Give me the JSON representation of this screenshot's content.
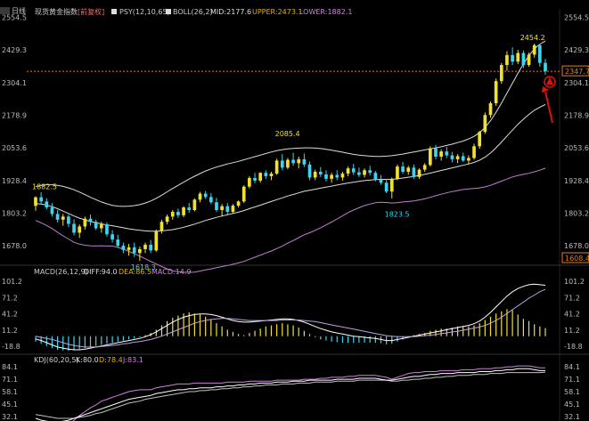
{
  "header": {
    "top_left_label": "日线",
    "symbol_label": "现货黄金指数",
    "adjust_label": "[前复权]",
    "psy_label": "PSY(12,10,65)",
    "boll_label": "BOLL(26,2)",
    "boll_mid": "MID:2177.6",
    "boll_upper": "UPPER:2473.1",
    "boll_lower": "LOWER:1882.1"
  },
  "macd_panel": {
    "title": "MACD(26,12,9)",
    "diff": "DIFF:94.0",
    "dea": "DEA:86.5",
    "macd": "MACD:14.9"
  },
  "kdj_panel": {
    "title": "KDJ(60,20,5)",
    "k": "K:80.0",
    "d": "D:78.4",
    "j": "J:83.1"
  },
  "axes": {
    "main_ticks": [
      "2554.5",
      "2429.3",
      "2304.1",
      "2178.9",
      "2053.6",
      "1928.4",
      "1803.2",
      "1678.0"
    ],
    "macd_ticks": [
      "101.2",
      "71.2",
      "41.2",
      "11.2",
      "-18.8"
    ],
    "kdj_ticks": [
      "84.1",
      "71.1",
      "58.1",
      "45.1",
      "32.1"
    ],
    "current_price": "2347.7",
    "lower_tag": "1608.4"
  },
  "annotations": {
    "high": "2454.2",
    "p1": "1882.5",
    "p2": "2085.4",
    "p3": "1823.5",
    "low": "1618.3"
  },
  "colors": {
    "up": "#f0e030",
    "down": "#3cd4f0",
    "boll": "#dddddd",
    "lower_band": "#c080d0",
    "price_line": "#e08020",
    "arrow": "#e01010",
    "macd_pos": "#f0e030",
    "macd_neg": "#3cd4f0"
  },
  "chart_data": {
    "type": "candlestick",
    "ylim": [
      1610,
      2560
    ],
    "ohlc": [
      [
        1831,
        1868,
        1812,
        1864
      ],
      [
        1864,
        1883,
        1840,
        1848
      ],
      [
        1848,
        1860,
        1818,
        1825
      ],
      [
        1825,
        1842,
        1790,
        1800
      ],
      [
        1800,
        1815,
        1768,
        1778
      ],
      [
        1778,
        1800,
        1755,
        1790
      ],
      [
        1790,
        1798,
        1750,
        1762
      ],
      [
        1762,
        1780,
        1718,
        1728
      ],
      [
        1728,
        1760,
        1708,
        1752
      ],
      [
        1752,
        1790,
        1740,
        1782
      ],
      [
        1782,
        1798,
        1755,
        1770
      ],
      [
        1770,
        1778,
        1738,
        1745
      ],
      [
        1745,
        1770,
        1728,
        1760
      ],
      [
        1760,
        1768,
        1712,
        1722
      ],
      [
        1722,
        1738,
        1690,
        1702
      ],
      [
        1702,
        1720,
        1670,
        1678
      ],
      [
        1678,
        1690,
        1650,
        1662
      ],
      [
        1662,
        1685,
        1640,
        1672
      ],
      [
        1672,
        1690,
        1635,
        1650
      ],
      [
        1650,
        1675,
        1620,
        1665
      ],
      [
        1665,
        1690,
        1650,
        1682
      ],
      [
        1682,
        1700,
        1650,
        1660
      ],
      [
        1660,
        1740,
        1655,
        1735
      ],
      [
        1735,
        1778,
        1725,
        1770
      ],
      [
        1770,
        1798,
        1760,
        1790
      ],
      [
        1790,
        1815,
        1778,
        1808
      ],
      [
        1808,
        1820,
        1785,
        1795
      ],
      [
        1795,
        1830,
        1788,
        1825
      ],
      [
        1825,
        1842,
        1805,
        1815
      ],
      [
        1815,
        1860,
        1810,
        1855
      ],
      [
        1855,
        1885,
        1845,
        1878
      ],
      [
        1878,
        1888,
        1858,
        1865
      ],
      [
        1865,
        1880,
        1838,
        1845
      ],
      [
        1845,
        1862,
        1808,
        1815
      ],
      [
        1815,
        1838,
        1790,
        1830
      ],
      [
        1830,
        1842,
        1798,
        1808
      ],
      [
        1808,
        1838,
        1800,
        1832
      ],
      [
        1832,
        1852,
        1825,
        1848
      ],
      [
        1848,
        1910,
        1842,
        1905
      ],
      [
        1905,
        1945,
        1898,
        1938
      ],
      [
        1938,
        1958,
        1918,
        1928
      ],
      [
        1928,
        1960,
        1920,
        1958
      ],
      [
        1958,
        1968,
        1935,
        1945
      ],
      [
        1945,
        1962,
        1930,
        1955
      ],
      [
        1955,
        2012,
        1950,
        2005
      ],
      [
        2005,
        2030,
        1968,
        1978
      ],
      [
        1978,
        2015,
        1972,
        2008
      ],
      [
        2008,
        2035,
        1985,
        1995
      ],
      [
        1995,
        2020,
        1975,
        2010
      ],
      [
        2010,
        2032,
        1980,
        1990
      ],
      [
        1990,
        2002,
        1930,
        1940
      ],
      [
        1940,
        1970,
        1930,
        1962
      ],
      [
        1962,
        1980,
        1942,
        1952
      ],
      [
        1952,
        1968,
        1925,
        1935
      ],
      [
        1935,
        1958,
        1920,
        1950
      ],
      [
        1950,
        1968,
        1930,
        1940
      ],
      [
        1940,
        1962,
        1928,
        1955
      ],
      [
        1955,
        1982,
        1945,
        1975
      ],
      [
        1975,
        1992,
        1950,
        1960
      ],
      [
        1960,
        1978,
        1942,
        1950
      ],
      [
        1950,
        1975,
        1940,
        1968
      ],
      [
        1968,
        1985,
        1948,
        1958
      ],
      [
        1958,
        1965,
        1925,
        1932
      ],
      [
        1932,
        1950,
        1912,
        1920
      ],
      [
        1920,
        1935,
        1880,
        1886
      ],
      [
        1886,
        1940,
        1860,
        1935
      ],
      [
        1935,
        1990,
        1930,
        1982
      ],
      [
        1982,
        2000,
        1955,
        1962
      ],
      [
        1962,
        1985,
        1950,
        1978
      ],
      [
        1978,
        1990,
        1935,
        1942
      ],
      [
        1942,
        1975,
        1935,
        1970
      ],
      [
        1970,
        1995,
        1962,
        1988
      ],
      [
        1988,
        2060,
        1982,
        2052
      ],
      [
        2052,
        2065,
        2010,
        2020
      ],
      [
        2020,
        2048,
        2005,
        2040
      ],
      [
        2040,
        2058,
        2015,
        2025
      ],
      [
        2025,
        2038,
        1998,
        2010
      ],
      [
        2010,
        2030,
        1995,
        2022
      ],
      [
        2022,
        2035,
        2000,
        2005
      ],
      [
        2005,
        2025,
        1990,
        2015
      ],
      [
        2015,
        2070,
        2008,
        2060
      ],
      [
        2060,
        2120,
        2050,
        2115
      ],
      [
        2115,
        2190,
        2108,
        2180
      ],
      [
        2180,
        2232,
        2170,
        2225
      ],
      [
        2225,
        2320,
        2215,
        2310
      ],
      [
        2310,
        2380,
        2300,
        2372
      ],
      [
        2372,
        2425,
        2350,
        2410
      ],
      [
        2410,
        2440,
        2372,
        2385
      ],
      [
        2385,
        2430,
        2375,
        2418
      ],
      [
        2418,
        2428,
        2360,
        2372
      ],
      [
        2372,
        2420,
        2365,
        2412
      ],
      [
        2412,
        2454,
        2400,
        2448
      ],
      [
        2448,
        2452,
        2365,
        2380
      ],
      [
        2380,
        2395,
        2335,
        2348
      ]
    ],
    "boll_mid": [
      1840,
      1838,
      1834,
      1828,
      1820,
      1811,
      1802,
      1792,
      1784,
      1777,
      1771,
      1766,
      1762,
      1758,
      1755,
      1751,
      1747,
      1743,
      1740,
      1737,
      1735,
      1734,
      1734,
      1735,
      1737,
      1740,
      1744,
      1749,
      1755,
      1761,
      1768,
      1775,
      1781,
      1787,
      1792,
      1797,
      1802,
      1807,
      1813,
      1820,
      1827,
      1834,
      1841,
      1848,
      1855,
      1862,
      1869,
      1875,
      1881,
      1887,
      1891,
      1895,
      1899,
      1903,
      1907,
      1911,
      1915,
      1919,
      1922,
      1925,
      1928,
      1930,
      1932,
      1933,
      1933,
      1933,
      1935,
      1938,
      1941,
      1944,
      1948,
      1952,
      1957,
      1962,
      1967,
      1972,
      1977,
      1982,
      1987,
      1992,
      1998,
      2006,
      2018,
      2034,
      2054,
      2076,
      2099,
      2122,
      2144,
      2164,
      2182,
      2198,
      2210,
      2220
    ],
    "boll_upper": [
      1905,
      1910,
      1912,
      1912,
      1910,
      1906,
      1900,
      1893,
      1884,
      1874,
      1864,
      1855,
      1846,
      1839,
      1833,
      1830,
      1829,
      1830,
      1832,
      1836,
      1842,
      1850,
      1860,
      1872,
      1885,
      1898,
      1910,
      1922,
      1934,
      1945,
      1955,
      1965,
      1973,
      1980,
      1986,
      1992,
      1997,
      2002,
      2008,
      2014,
      2020,
      2026,
      2032,
      2038,
      2043,
      2047,
      2050,
      2052,
      2053,
      2054,
      2054,
      2053,
      2051,
      2048,
      2045,
      2041,
      2037,
      2033,
      2029,
      2026,
      2024,
      2022,
      2021,
      2021,
      2022,
      2024,
      2027,
      2030,
      2034,
      2038,
      2042,
      2046,
      2050,
      2054,
      2058,
      2063,
      2068,
      2074,
      2080,
      2088,
      2098,
      2112,
      2132,
      2158,
      2190,
      2226,
      2264,
      2302,
      2340,
      2376,
      2408,
      2434,
      2452,
      2464
    ],
    "boll_lower": [
      1775,
      1766,
      1756,
      1744,
      1730,
      1716,
      1704,
      1691,
      1684,
      1680,
      1678,
      1677,
      1678,
      1677,
      1677,
      1672,
      1665,
      1656,
      1648,
      1638,
      1628,
      1618,
      1608,
      1598,
      1589,
      1582,
      1578,
      1576,
      1576,
      1577,
      1581,
      1585,
      1589,
      1594,
      1598,
      1602,
      1607,
      1612,
      1618,
      1626,
      1634,
      1642,
      1650,
      1658,
      1667,
      1677,
      1688,
      1698,
      1709,
      1720,
      1728,
      1737,
      1747,
      1758,
      1769,
      1781,
      1793,
      1805,
      1815,
      1824,
      1832,
      1838,
      1843,
      1845,
      1844,
      1842,
      1843,
      1846,
      1848,
      1850,
      1854,
      1858,
      1864,
      1870,
      1876,
      1881,
      1886,
      1890,
      1894,
      1896,
      1898,
      1900,
      1904,
      1910,
      1918,
      1926,
      1934,
      1942,
      1948,
      1952,
      1956,
      1962,
      1968,
      1976
    ],
    "macd_bars": [
      -10,
      -14,
      -18,
      -22,
      -25,
      -26,
      -27,
      -26,
      -24,
      -22,
      -20,
      -18,
      -16,
      -14,
      -12,
      -10,
      -8,
      -6,
      -4,
      -2,
      2,
      6,
      12,
      20,
      28,
      34,
      38,
      42,
      44,
      42,
      40,
      36,
      30,
      24,
      18,
      12,
      8,
      4,
      2,
      6,
      10,
      14,
      18,
      20,
      22,
      24,
      22,
      20,
      16,
      10,
      4,
      -2,
      -6,
      -8,
      -10,
      -11,
      -12,
      -12,
      -12,
      -12,
      -12,
      -12,
      -12,
      -13,
      -15,
      -14,
      -10,
      -6,
      -2,
      2,
      4,
      6,
      10,
      12,
      14,
      14,
      16,
      18,
      18,
      18,
      20,
      24,
      30,
      36,
      42,
      46,
      50,
      48,
      40,
      32,
      28,
      22,
      18,
      15
    ],
    "macd_diff": [
      -5,
      -8,
      -12,
      -16,
      -20,
      -22,
      -24,
      -25,
      -25,
      -24,
      -22,
      -20,
      -18,
      -16,
      -14,
      -12,
      -10,
      -8,
      -6,
      -4,
      -1,
      3,
      8,
      14,
      20,
      26,
      31,
      35,
      38,
      40,
      41,
      41,
      40,
      38,
      35,
      32,
      29,
      27,
      26,
      26,
      27,
      28,
      29,
      30,
      31,
      32,
      32,
      31,
      29,
      26,
      22,
      18,
      14,
      11,
      8,
      6,
      4,
      2,
      0,
      -1,
      -2,
      -3,
      -4,
      -6,
      -8,
      -8,
      -6,
      -4,
      -2,
      0,
      2,
      4,
      6,
      8,
      10,
      12,
      14,
      16,
      18,
      20,
      23,
      28,
      35,
      44,
      54,
      64,
      74,
      82,
      88,
      92,
      95,
      96,
      95,
      94
    ],
    "macd_dea": [
      0,
      -2,
      -4,
      -6,
      -9,
      -12,
      -15,
      -17,
      -19,
      -20,
      -20,
      -20,
      -19,
      -18,
      -17,
      -16,
      -14,
      -13,
      -11,
      -10,
      -8,
      -6,
      -3,
      0,
      4,
      8,
      12,
      16,
      20,
      24,
      27,
      29,
      31,
      32,
      33,
      33,
      32,
      31,
      30,
      29,
      29,
      29,
      29,
      29,
      29,
      30,
      30,
      30,
      30,
      29,
      28,
      27,
      25,
      23,
      21,
      19,
      17,
      15,
      13,
      11,
      9,
      7,
      5,
      3,
      1,
      0,
      -1,
      -1,
      -1,
      -1,
      0,
      1,
      2,
      3,
      5,
      6,
      8,
      9,
      11,
      13,
      15,
      17,
      20,
      24,
      29,
      35,
      42,
      49,
      56,
      63,
      70,
      76,
      82,
      86.5
    ],
    "kdj_k": [
      30,
      28,
      27,
      26,
      26,
      27,
      28,
      30,
      32,
      34,
      36,
      38,
      40,
      42,
      44,
      46,
      48,
      50,
      51,
      52,
      53,
      54,
      56,
      57,
      58,
      59,
      60,
      60,
      61,
      61,
      62,
      62,
      62,
      63,
      63,
      64,
      64,
      65,
      65,
      66,
      66,
      67,
      67,
      67,
      68,
      68,
      68,
      69,
      69,
      69,
      70,
      70,
      70,
      70,
      70,
      71,
      71,
      71,
      71,
      72,
      72,
      72,
      72,
      71,
      70,
      70,
      71,
      72,
      73,
      74,
      74,
      75,
      76,
      76,
      77,
      77,
      77,
      78,
      78,
      78,
      78,
      79,
      79,
      79,
      80,
      80,
      81,
      81,
      82,
      82,
      82,
      81,
      80,
      80
    ],
    "kdj_d": [
      34,
      33,
      32,
      31,
      30,
      30,
      30,
      30,
      31,
      32,
      33,
      35,
      36,
      38,
      40,
      42,
      44,
      46,
      47,
      48,
      50,
      51,
      52,
      53,
      54,
      55,
      56,
      57,
      58,
      58,
      59,
      59,
      60,
      60,
      61,
      61,
      62,
      62,
      63,
      63,
      64,
      64,
      65,
      65,
      65,
      66,
      66,
      66,
      67,
      67,
      67,
      68,
      68,
      68,
      68,
      69,
      69,
      69,
      69,
      70,
      70,
      70,
      70,
      70,
      70,
      69,
      69,
      70,
      70,
      71,
      71,
      72,
      72,
      73,
      73,
      74,
      74,
      75,
      75,
      75,
      76,
      76,
      76,
      77,
      77,
      77,
      78,
      78,
      78,
      78,
      78,
      78,
      78,
      78.4
    ],
    "kdj_j": [
      25,
      22,
      20,
      18,
      19,
      21,
      24,
      28,
      33,
      37,
      41,
      44,
      48,
      50,
      52,
      54,
      56,
      58,
      59,
      60,
      60,
      60,
      62,
      63,
      64,
      65,
      66,
      66,
      66,
      67,
      67,
      67,
      67,
      67,
      67,
      68,
      68,
      68,
      68,
      69,
      69,
      69,
      69,
      69,
      70,
      70,
      70,
      70,
      70,
      71,
      71,
      71,
      72,
      72,
      73,
      73,
      73,
      74,
      74,
      75,
      75,
      75,
      75,
      74,
      73,
      71,
      73,
      75,
      77,
      78,
      78,
      79,
      79,
      79,
      80,
      80,
      80,
      80,
      81,
      81,
      81,
      82,
      82,
      82,
      83,
      83,
      84,
      84,
      85,
      85,
      85,
      84,
      83,
      83
    ]
  }
}
